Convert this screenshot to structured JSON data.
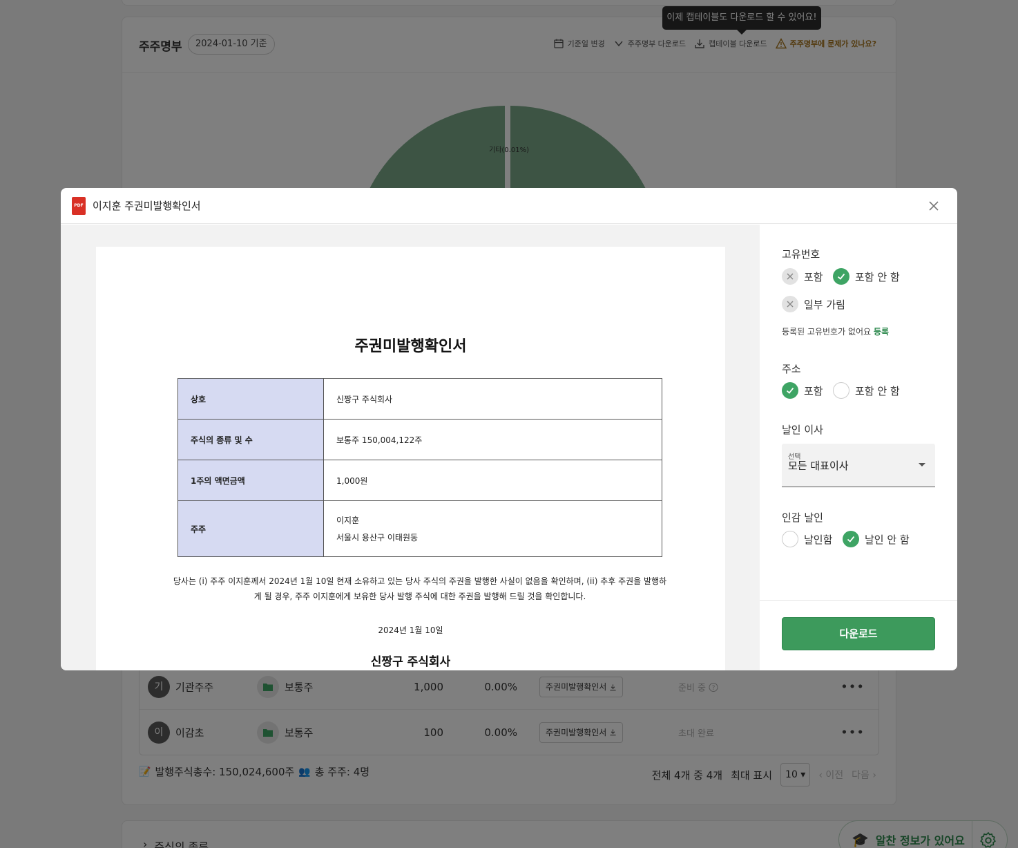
{
  "background": {
    "card": {
      "title": "주주명부",
      "date_chip": "2024-01-10 기준",
      "actions": {
        "change_date": "기준일 변경",
        "download_register": "주주명부 다운로드",
        "download_cap_table": "캡테이블 다운로드",
        "report_issue": "주주명부에 문제가 있나요?"
      },
      "tooltip": "이제 캡테이블도 다운로드 할 수 있어요!",
      "chart_data": {
        "type": "pie",
        "labels": [
          "기타(0.01%)"
        ]
      }
    },
    "table": {
      "rows": [
        {
          "avatar": "기",
          "name": "기관주주",
          "type": "보통주",
          "shares": "1,000",
          "percent": "0.00%",
          "doc_button": "주권미발행확인서",
          "status": "준비 중"
        },
        {
          "avatar": "이",
          "name": "이감초",
          "type": "보통주",
          "shares": "100",
          "percent": "0.00%",
          "doc_button": "주권미발행확인서",
          "status": "초대 완료"
        }
      ]
    },
    "footer": {
      "total_shares": "발행주식총수: 150,024,600주",
      "total_holders": "총 주주: 4명",
      "count": "전체 4개 중 4개",
      "max_label": "최대 표시",
      "max_value": "10",
      "prev": "이전",
      "next": "다음"
    },
    "card2_title": "주식의 종류",
    "help_pill": "알찬 정보가 있어요"
  },
  "modal": {
    "title": "이지훈 주권미발행확인서",
    "pdf_badge": "PDF",
    "document": {
      "title": "주권미발행확인서",
      "rows": [
        {
          "key": "상호",
          "value": "신짱구 주식회사"
        },
        {
          "key": "주식의 종류 및 수",
          "value": "보통주 150,004,122주"
        },
        {
          "key": "1주의 액면금액",
          "value": "1,000원"
        },
        {
          "key": "주주",
          "value": "이지훈",
          "value2": "서울시 용산구 이태원동"
        }
      ],
      "paragraph": "당사는 (i) 주주 이지훈께서 2024년 1월 10일 현재 소유하고 있는 당사 주식의 주권을 발행한 사실이 없음을 확인하며, (ii) 추후 주권을 발행하게 될 경우, 주주 이지훈에게 보유한 당사 발행 주식에 대한 주권을 발행해 드릴 것을 확인합니다.",
      "date": "2024년 1월 10일",
      "company": "신짱구 주식회사"
    },
    "options": {
      "id_number": {
        "label": "고유번호",
        "include": "포함",
        "exclude": "포함 안 함",
        "partial": "일부 가림",
        "hint": "등록된 고유번호가 없어요",
        "register_link": "등록"
      },
      "address": {
        "label": "주소",
        "include": "포함",
        "exclude": "포함 안 함"
      },
      "director": {
        "label": "날인 이사",
        "select_label": "선택",
        "select_value": "모든 대표이사"
      },
      "seal": {
        "label": "인감 날인",
        "stamp": "날인함",
        "no_stamp": "날인 안 함"
      }
    },
    "download_button": "다운로드"
  }
}
